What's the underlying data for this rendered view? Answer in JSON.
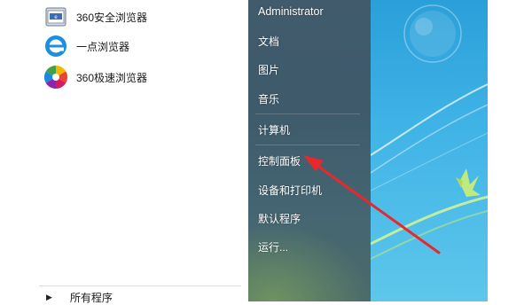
{
  "left_programs": [
    {
      "label": "360安全浏览器",
      "icon": "browser-360-safe-icon"
    },
    {
      "label": "一点浏览器",
      "icon": "yidian-browser-icon"
    },
    {
      "label": "360极速浏览器",
      "icon": "browser-360-speed-icon"
    }
  ],
  "all_programs": {
    "label": "所有程序",
    "icon": "triangle-right-icon"
  },
  "right_menu": {
    "user": "Administrator",
    "items": [
      "文档",
      "图片",
      "音乐",
      "计算机",
      "控制面板",
      "设备和打印机",
      "默认程序",
      "运行..."
    ]
  },
  "colors": {
    "arrow": "#e8282b",
    "right_pane": "#3e5a6b",
    "desktop": "#3fb2e6"
  }
}
